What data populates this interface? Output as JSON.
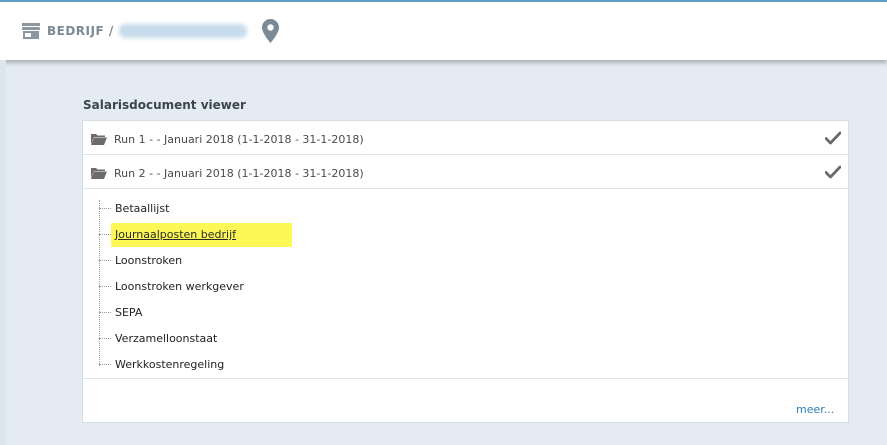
{
  "header": {
    "breadcrumb_root": "BEDRIJF / ",
    "icons": {
      "store": "store-icon",
      "location": "map-pin-icon"
    },
    "colors": {
      "accent": "#5f9fc6",
      "icon": "#8a96a0"
    }
  },
  "section": {
    "title": "Salarisdocument viewer"
  },
  "runs": [
    {
      "label": "Run 1 - - Januari 2018 (1-1-2018 - 31-1-2018)",
      "status_icon": "check-icon"
    },
    {
      "label": "Run 2 - - Januari 2018 (1-1-2018 - 31-1-2018)",
      "status_icon": "check-icon"
    }
  ],
  "documents": [
    {
      "label": "Betaallijst"
    },
    {
      "label": "Journaalposten bedrijf",
      "highlighted": true
    },
    {
      "label": "Loonstroken"
    },
    {
      "label": "Loonstroken werkgever"
    },
    {
      "label": "SEPA"
    },
    {
      "label": "Verzamelloonstaat"
    },
    {
      "label": "Werkkostenregeling"
    }
  ],
  "footer": {
    "more_label": "meer..."
  },
  "colors": {
    "highlight": "#fdf855",
    "link": "#2d7fb8",
    "background": "#e4ebf3"
  }
}
